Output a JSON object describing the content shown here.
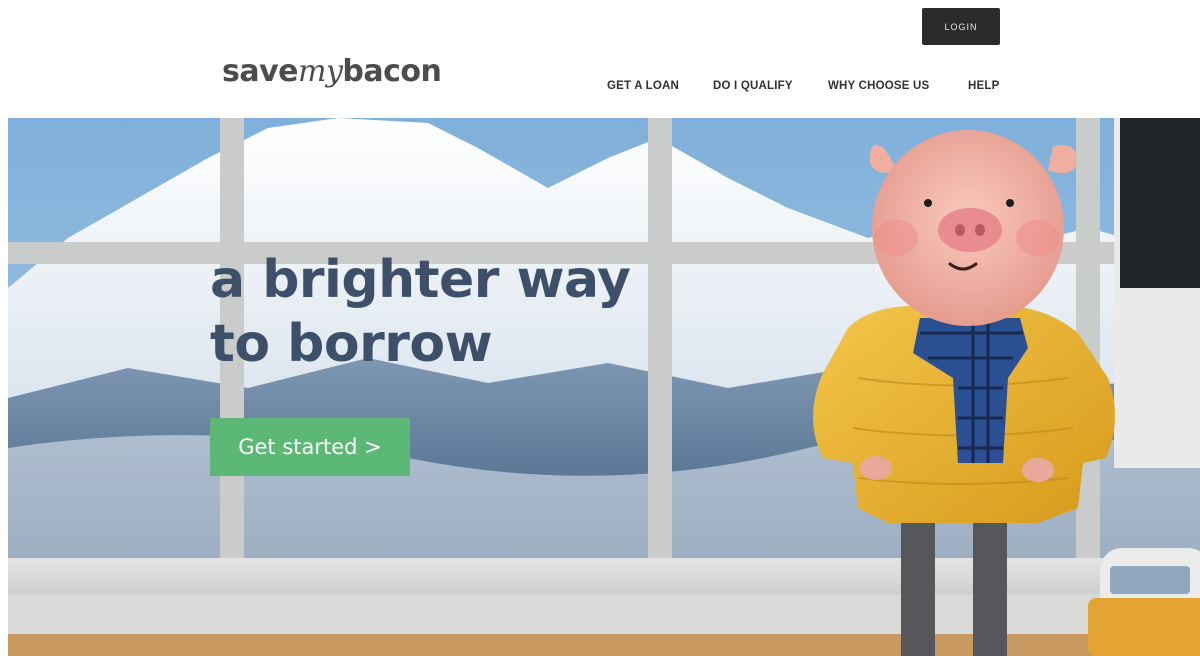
{
  "header": {
    "logo": {
      "part1": "save",
      "part2": "my",
      "part3": "bacon"
    },
    "login_label": "LOGIN",
    "nav": [
      {
        "label": "GET A LOAN"
      },
      {
        "label": "DO I QUALIFY"
      },
      {
        "label": "WHY CHOOSE US"
      },
      {
        "label": "HELP"
      }
    ]
  },
  "hero": {
    "headline_line1": "a brighter way",
    "headline_line2": "to borrow",
    "cta_label": "Get started >",
    "image_description_icons": [
      "mountain-landscape",
      "window-frame",
      "pig-mascot",
      "scarf",
      "yellow-jacket",
      "van"
    ]
  },
  "colors": {
    "accent_green": "#5cb875",
    "headline_navy": "#3e5069",
    "login_bg": "#2b2b2b",
    "jacket_yellow": "#e9b22c",
    "pig_pink": "#f3b7aa"
  }
}
